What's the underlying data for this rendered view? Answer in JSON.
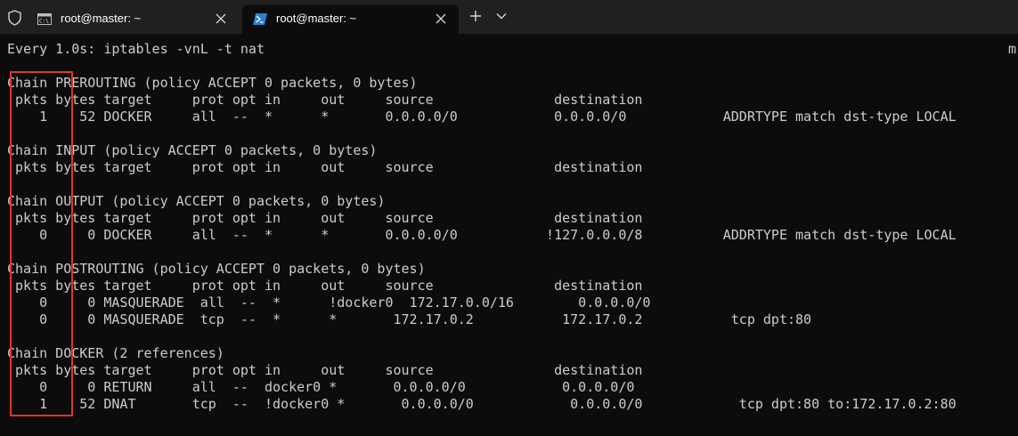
{
  "tabs": [
    {
      "title": "root@master: ~",
      "icon": "cmd-icon",
      "active": false
    },
    {
      "title": "root@master: ~",
      "icon": "powershell-icon",
      "active": true
    }
  ],
  "tabbar": {
    "new_tab_icon": "plus-icon",
    "dropdown_icon": "chevron-down-icon",
    "shield_icon": "shield-icon"
  },
  "terminal": {
    "right_edge_text": "m",
    "lines": [
      "Every 1.0s: iptables -vnL -t nat",
      "",
      "Chain PREROUTING (policy ACCEPT 0 packets, 0 bytes)",
      " pkts bytes target     prot opt in     out     source               destination",
      "    1    52 DOCKER     all  --  *      *       0.0.0.0/0            0.0.0.0/0            ADDRTYPE match dst-type LOCAL",
      "",
      "Chain INPUT (policy ACCEPT 0 packets, 0 bytes)",
      " pkts bytes target     prot opt in     out     source               destination",
      "",
      "Chain OUTPUT (policy ACCEPT 0 packets, 0 bytes)",
      " pkts bytes target     prot opt in     out     source               destination",
      "    0     0 DOCKER     all  --  *      *       0.0.0.0/0           !127.0.0.0/8          ADDRTYPE match dst-type LOCAL",
      "",
      "Chain POSTROUTING (policy ACCEPT 0 packets, 0 bytes)",
      " pkts bytes target     prot opt in     out     source               destination",
      "    0     0 MASQUERADE  all  --  *      !docker0  172.17.0.0/16        0.0.0.0/0",
      "    0     0 MASQUERADE  tcp  --  *      *       172.17.0.2           172.17.0.2           tcp dpt:80",
      "",
      "Chain DOCKER (2 references)",
      " pkts bytes target     prot opt in     out     source               destination",
      "    0     0 RETURN     all  --  docker0 *       0.0.0.0/0            0.0.0.0/0",
      "    1    52 DNAT       tcp  --  !docker0 *       0.0.0.0/0            0.0.0.0/0            tcp dpt:80 to:172.17.0.2:80"
    ]
  },
  "colors": {
    "terminal_bg": "#0c0c0c",
    "terminal_fg": "#cccccc",
    "tabbar_bg": "#202020",
    "highlight_border": "#e0362c"
  }
}
